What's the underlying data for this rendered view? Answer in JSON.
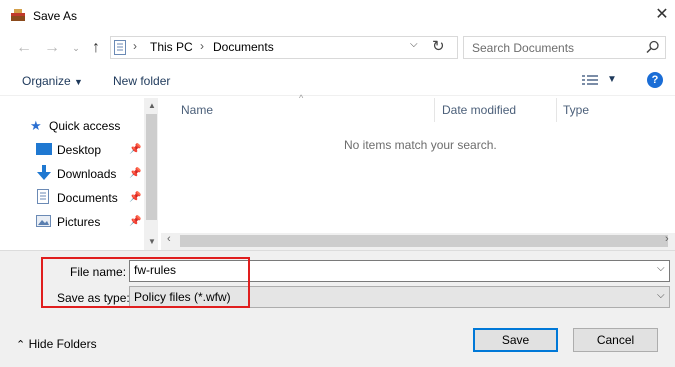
{
  "window": {
    "title": "Save As"
  },
  "address": {
    "segments": [
      "This PC",
      "Documents"
    ]
  },
  "search": {
    "placeholder": "Search Documents"
  },
  "toolbar": {
    "organize_label": "Organize",
    "new_folder_label": "New folder",
    "help_label": "?"
  },
  "sidebar": {
    "items": [
      {
        "label": "Quick access",
        "icon": "star-icon"
      },
      {
        "label": "Desktop",
        "icon": "desktop-icon"
      },
      {
        "label": "Downloads",
        "icon": "download-arrow-icon"
      },
      {
        "label": "Documents",
        "icon": "document-icon"
      },
      {
        "label": "Pictures",
        "icon": "pictures-icon"
      }
    ]
  },
  "file_list": {
    "columns": [
      "Name",
      "Date modified",
      "Type"
    ],
    "empty_message": "No items match your search."
  },
  "form": {
    "file_name_label": "File name:",
    "file_name_value": "fw-rules",
    "save_type_label": "Save as type:",
    "save_type_value": "Policy files (*.wfw)"
  },
  "footer": {
    "hide_folders_label": "Hide Folders",
    "save_label": "Save",
    "cancel_label": "Cancel"
  },
  "colors": {
    "accent": "#0078d7",
    "highlight": "#e01e1e",
    "link": "#1e395b"
  }
}
